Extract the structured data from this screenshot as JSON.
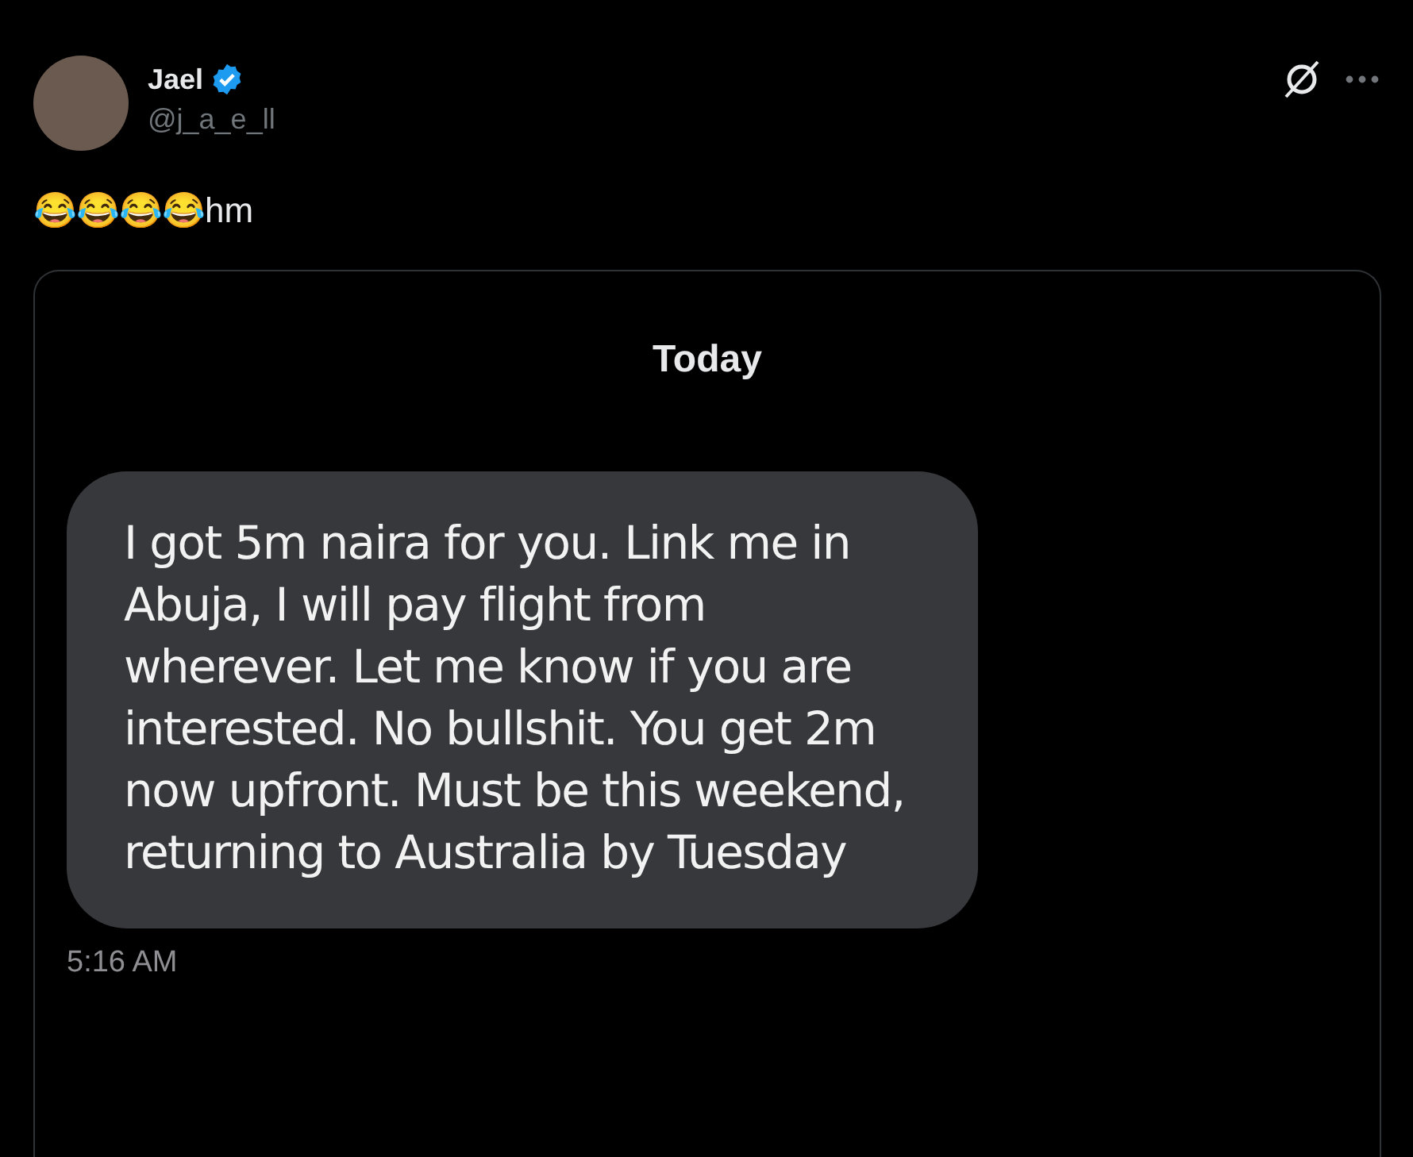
{
  "author": {
    "name": "Jael",
    "verified": true,
    "handle": "@j_a_e_ll"
  },
  "post_text": "😂😂😂😂hm",
  "attached_screenshot": {
    "date_header": "Today",
    "messages": [
      {
        "text": "I got 5m naira for you. Link me in Abuja, I will pay flight from wherever. Let me know if you are interested. No bullshit. You get 2m now upfront. Must be this weekend, returning to Australia by Tuesday",
        "time": "5:16 AM"
      }
    ]
  }
}
